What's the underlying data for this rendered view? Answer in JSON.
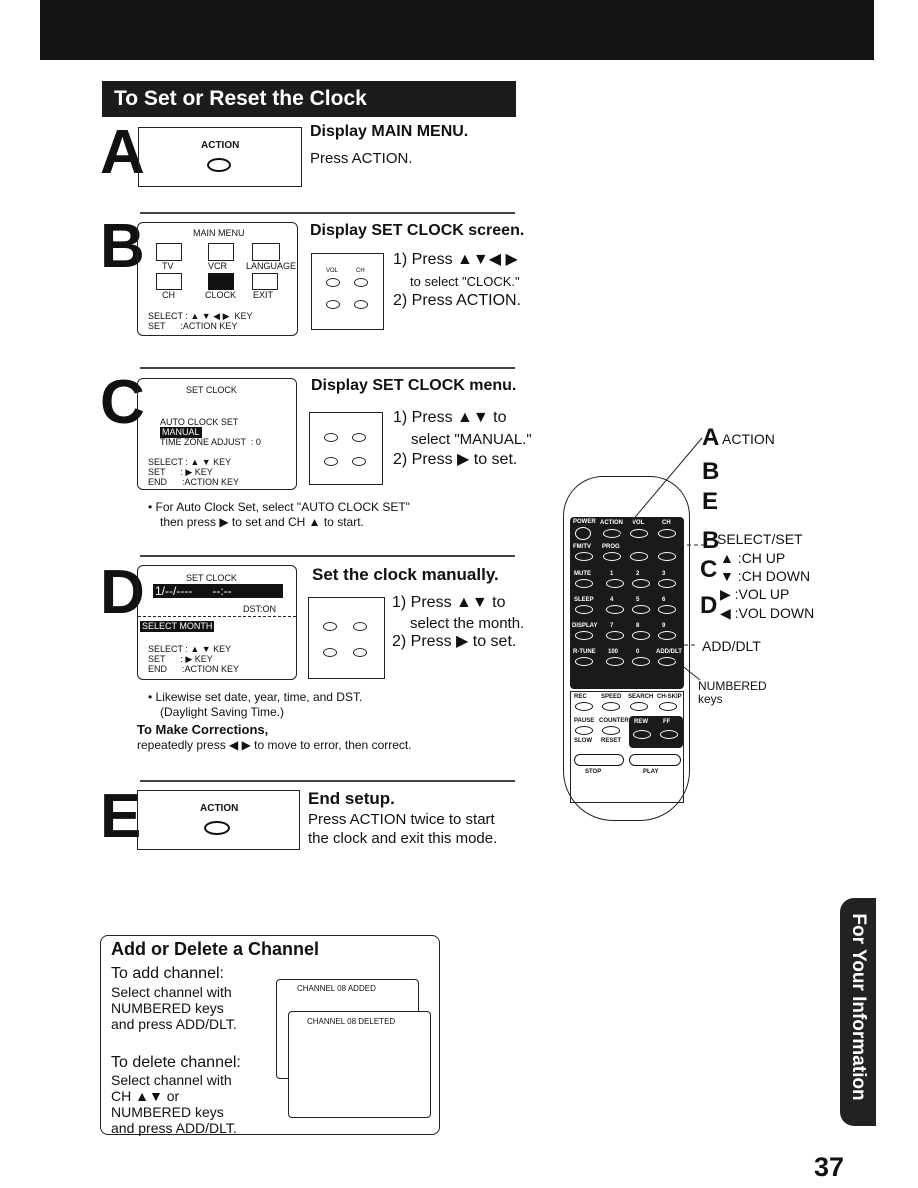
{
  "title": "To Set or Reset the Clock",
  "steps": {
    "A": {
      "letter": "A",
      "heading": "Display MAIN MENU.",
      "text": "Press ACTION.",
      "button_label": "ACTION"
    },
    "B": {
      "letter": "B",
      "heading": "Display SET CLOCK screen.",
      "step1": "1) Press ▲▼◀ ▶",
      "step1b": "to select \"CLOCK.\"",
      "step2": "2) Press ACTION.",
      "screen": {
        "title": "MAIN MENU",
        "icons": [
          "TV",
          "VCR",
          "LANGUAGE",
          "CH",
          "CLOCK",
          "EXIT"
        ],
        "line1": "SELECT : ▲ ▼ ◀ ▶  KEY",
        "line2": "SET      :ACTION KEY"
      }
    },
    "C": {
      "letter": "C",
      "heading": "Display SET CLOCK menu.",
      "step1": "1) Press ▲▼ to",
      "step1b": "select \"MANUAL.\"",
      "step2": "2) Press ▶ to set.",
      "screen": {
        "title": "SET CLOCK",
        "opt1": "AUTO CLOCK SET",
        "opt2": "MANUAL",
        "opt3": "TIME ZONE ADJUST  : 0",
        "line1": "SELECT : ▲ ▼ KEY",
        "line2": "SET      : ▶ KEY",
        "line3": "END      :ACTION KEY"
      },
      "note1": "• For Auto Clock Set, select \"AUTO CLOCK SET\"",
      "note2": "then press ▶ to set and CH ▲ to start."
    },
    "D": {
      "letter": "D",
      "heading": "Set the clock manually.",
      "step1": "1) Press ▲▼ to",
      "step1b": "select the month.",
      "step2": "2) Press ▶ to set.",
      "screen": {
        "title": "SET CLOCK",
        "display": "1/--/----      --:--",
        "dst": "DST:ON",
        "prompt": "SELECT MONTH",
        "line1": "SELECT : ▲ ▼  KEY",
        "line2": "SET      : ▶ KEY",
        "line3": "END      :ACTION KEY"
      },
      "note1": "• Likewise set date, year, time, and DST.",
      "note2": "(Daylight Saving Time.)",
      "corr_heading": "To Make Corrections,",
      "corr_text": "repeatedly press ◀ ▶ to move to error, then correct."
    },
    "E": {
      "letter": "E",
      "heading": "End setup.",
      "text1": "Press ACTION twice to start",
      "text2": "the clock and exit this mode.",
      "button_label": "ACTION"
    }
  },
  "keypad": {
    "vol": "VOL",
    "ch": "CH",
    "set": "SET",
    "select": "SELECT"
  },
  "remote": {
    "labels": {
      "a": "A",
      "action": "ACTION",
      "b": "B",
      "e": "E",
      "b2": "B",
      "select_set": "SELECT/SET",
      "c": "C",
      "ch_up": "▲ :CH UP",
      "ch_down": "▼ :CH DOWN",
      "d": "D",
      "vol_up": "▶ :VOL UP",
      "vol_down": "◀ :VOL DOWN",
      "add_dlt": "ADD/DLT",
      "numbered": "NUMBERED",
      "keys": "keys"
    },
    "buttons": [
      "POWER",
      "ACTION",
      "FM/TV",
      "PROG",
      "MUTE",
      "SLEEP",
      "DISPLAY",
      "R-TUNE",
      "REC",
      "SPEED",
      "SEARCH",
      "CH-SKIP",
      "PAUSE",
      "COUNTER",
      "SLOW",
      "RESET",
      "REW",
      "FF",
      "STOP",
      "PLAY",
      "ADD/DLT"
    ],
    "numbers": [
      "1",
      "2",
      "3",
      "4",
      "5",
      "6",
      "7",
      "8",
      "9",
      "100",
      "0"
    ]
  },
  "channel": {
    "heading": "Add or Delete a Channel",
    "add_title": "To add channel:",
    "add1": "Select channel with",
    "add2": "NUMBERED keys",
    "add3": "and press ADD/DLT.",
    "del_title": "To delete channel:",
    "del1": "Select channel with",
    "del2": "CH ▲▼ or",
    "del3": "NUMBERED keys",
    "del4": "and press ADD/DLT.",
    "screen_added": "CHANNEL  08  ADDED",
    "screen_deleted": "CHANNEL  08  DELETED"
  },
  "side_tab": "For Your Information",
  "page_number": "37"
}
